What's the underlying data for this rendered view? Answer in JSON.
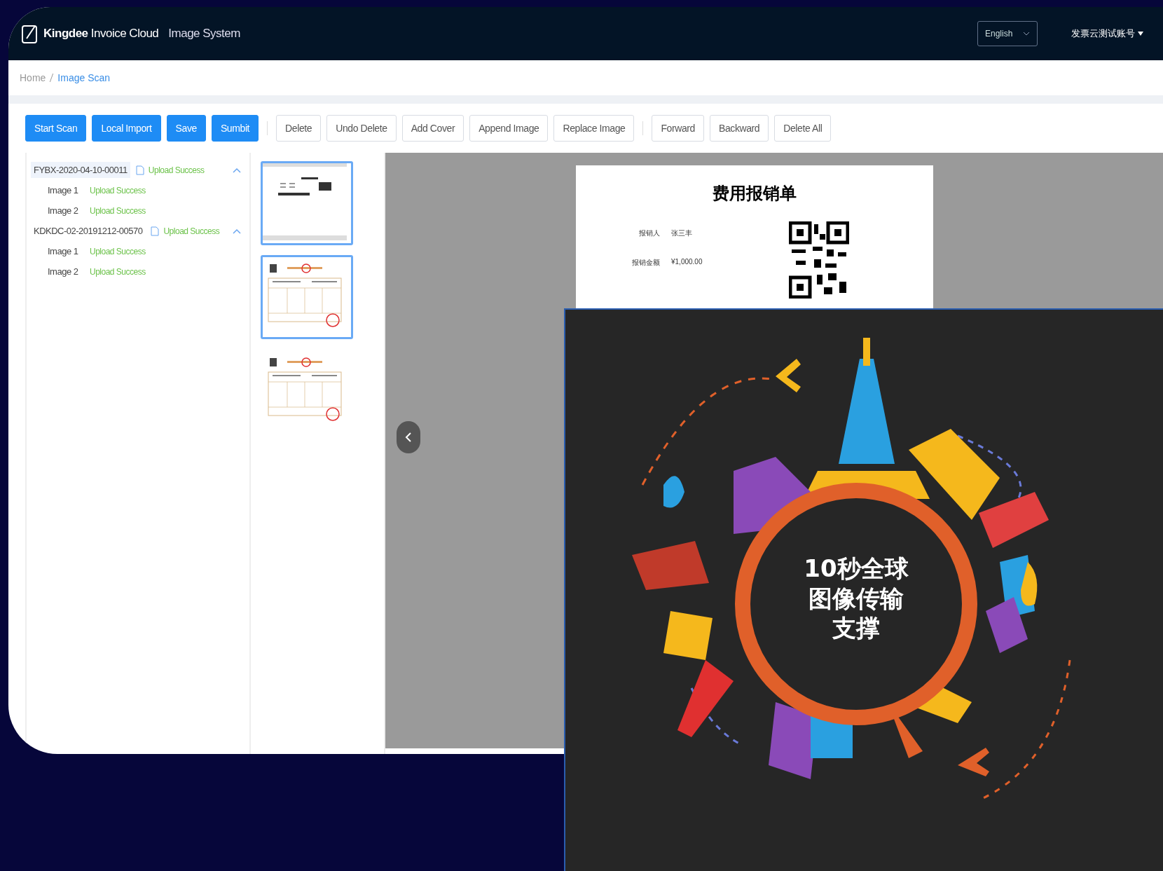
{
  "header": {
    "brand_bold": "Kingdee",
    "brand": "Invoice Cloud",
    "system": "Image System",
    "language": "English",
    "user": "发票云测试账号"
  },
  "breadcrumb": [
    {
      "label": "Home",
      "current": false
    },
    {
      "label": "Image Scan",
      "current": true
    }
  ],
  "toolbar": [
    [
      {
        "label": "Start Scan",
        "kind": "primary"
      },
      {
        "label": "Local Import",
        "kind": "primary"
      },
      {
        "label": "Save",
        "kind": "primary"
      },
      {
        "label": "Sumbit",
        "kind": "primary"
      }
    ],
    [
      {
        "label": "Delete",
        "kind": "default"
      },
      {
        "label": "Undo Delete",
        "kind": "default"
      },
      {
        "label": "Add Cover",
        "kind": "default"
      },
      {
        "label": "Append Image",
        "kind": "default"
      },
      {
        "label": "Replace Image",
        "kind": "default"
      }
    ],
    [
      {
        "label": "Forward",
        "kind": "default"
      },
      {
        "label": "Backward",
        "kind": "default"
      },
      {
        "label": "Delete All",
        "kind": "default"
      }
    ]
  ],
  "tree": [
    {
      "label": "FYBX-2020-04-10-00011",
      "status": "Upload Success",
      "selected": true,
      "expanded": true,
      "children": [
        {
          "label": "Image 1",
          "status": "Upload Success"
        },
        {
          "label": "Image 2",
          "status": "Upload Success"
        }
      ]
    },
    {
      "label": "KDKDC-02-20191212-00570",
      "status": "Upload Success",
      "selected": false,
      "expanded": true,
      "children": [
        {
          "label": "Image 1",
          "status": "Upload Success"
        },
        {
          "label": "Image 2",
          "status": "Upload Success"
        }
      ]
    }
  ],
  "thumbnails": [
    {
      "kind": "expense",
      "selected": true
    },
    {
      "kind": "invoice",
      "selected": true
    },
    {
      "kind": "invoice",
      "selected": false
    }
  ],
  "document": {
    "title": "费用报销单",
    "fields": [
      {
        "label": "报销人",
        "value": "张三丰"
      },
      {
        "label": "报销金额",
        "value": "¥1,000.00"
      }
    ]
  },
  "promo": {
    "lines": [
      "10秒全球",
      "图像传输",
      "支撑"
    ]
  }
}
